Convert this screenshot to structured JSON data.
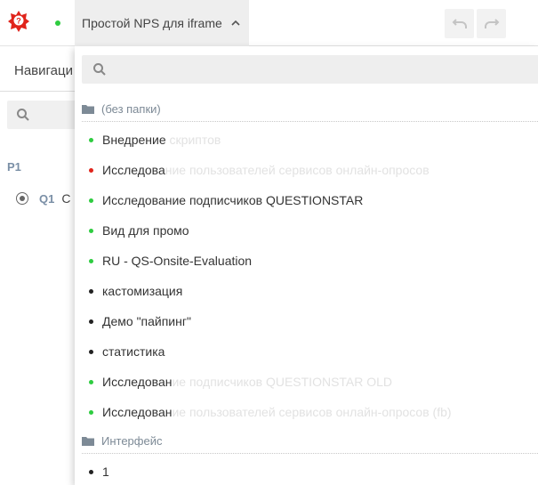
{
  "header": {
    "survey_title": "Простой NPS для iframe",
    "status_color": "#2ecc40",
    "icons": {
      "logo": "questionstar-logo",
      "undo": "undo-icon",
      "redo": "redo-icon",
      "dropdown": "chevron-up-icon"
    }
  },
  "left_panel": {
    "nav_label": "Навигаци",
    "page": "P1",
    "question": {
      "code": "Q1",
      "text": "С"
    }
  },
  "dropdown": {
    "search_placeholder": "",
    "groups": [
      {
        "name": "(без папки)",
        "items": [
          {
            "label": "Внедрение скриптов",
            "status_color": "#2ecc40"
          },
          {
            "label": "Исследование пользователей сервисов онлайн-опросов",
            "status_color": "#e0241b"
          },
          {
            "label": "Исследование подписчиков QUESTIONSTAR",
            "status_color": "#2ecc40"
          },
          {
            "label": "Вид для промо",
            "status_color": "#2ecc40"
          },
          {
            "label": "RU - QS-Onsite-Evaluation",
            "status_color": "#2ecc40"
          },
          {
            "label": "кастомизация",
            "status_color": "#222222"
          },
          {
            "label": "Демо \"пайпинг\"",
            "status_color": "#222222"
          },
          {
            "label": "статистика",
            "status_color": "#222222"
          },
          {
            "label": "Исследование подписчиков QUESTIONSTAR OLD",
            "status_color": "#2ecc40"
          },
          {
            "label": "Исследование пользователей сервисов онлайн-опросов (fb)",
            "status_color": "#2ecc40"
          }
        ]
      },
      {
        "name": "Интерфейс",
        "items": [
          {
            "label": "1",
            "status_color": "#222222"
          }
        ]
      }
    ]
  }
}
